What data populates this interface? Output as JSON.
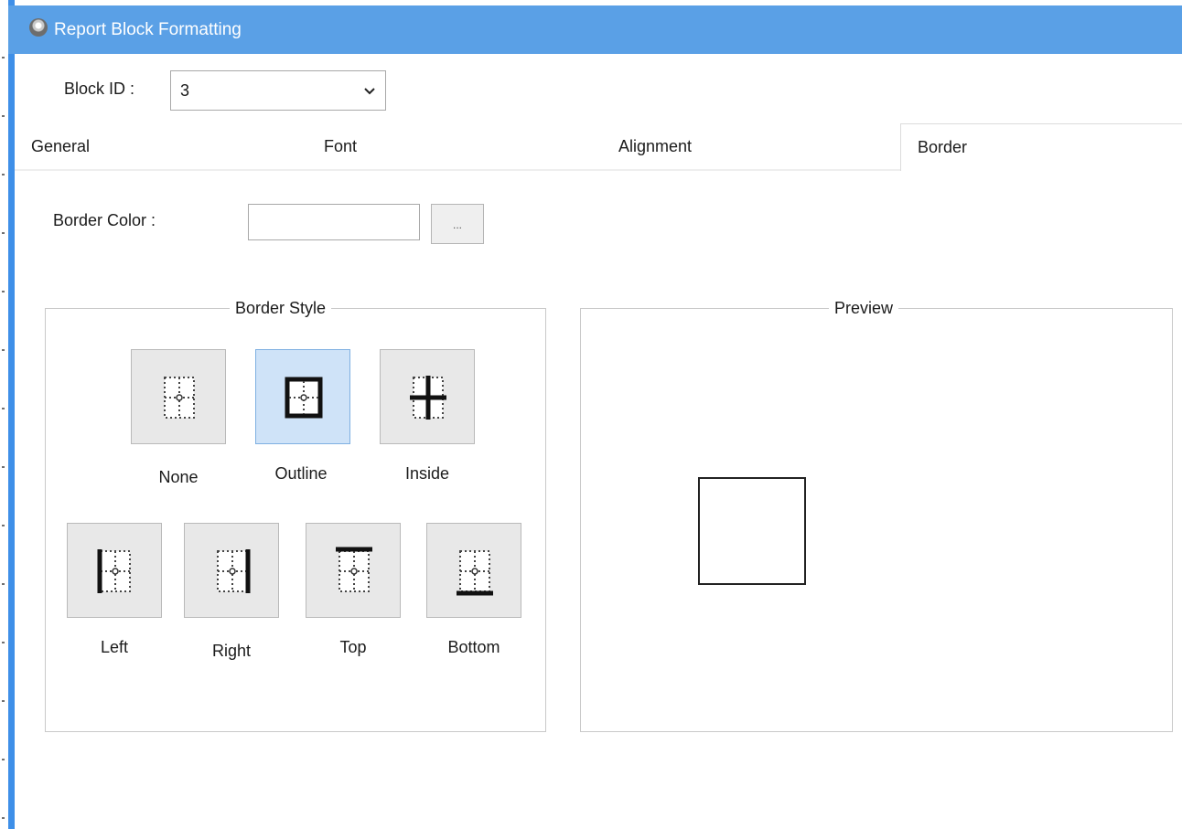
{
  "window": {
    "title": "Report Block Formatting"
  },
  "block": {
    "label": "Block ID :",
    "value": "3"
  },
  "tabs": [
    "General",
    "Font",
    "Alignment",
    "Border"
  ],
  "active_tab": "Border",
  "border": {
    "color_label": "Border Color :",
    "color_value": "",
    "browse_label": "...",
    "style_group_title": "Border Style",
    "preview_title": "Preview",
    "selected_style": "Outline",
    "styles": [
      "None",
      "Outline",
      "Inside",
      "Left",
      "Right",
      "Top",
      "Bottom"
    ]
  },
  "colors": {
    "titlebar": "#5aa0e6",
    "selected": "#cfe3f8",
    "accent": "#3e8fe8"
  }
}
